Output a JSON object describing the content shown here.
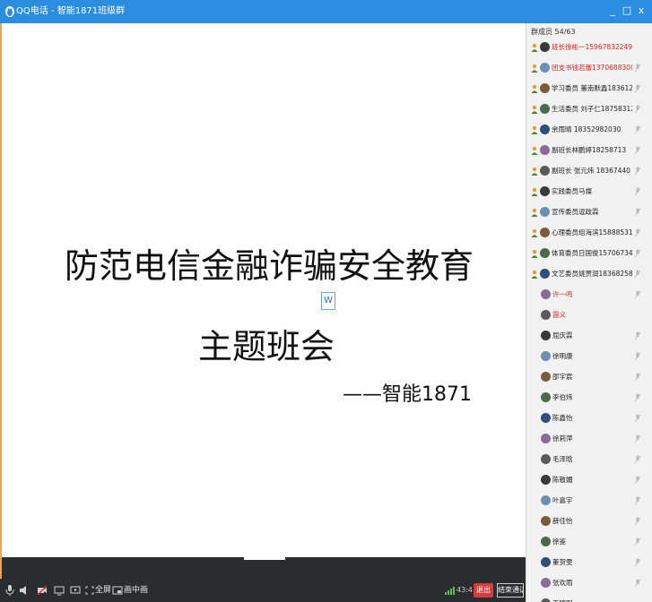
{
  "window": {
    "title": "QQ电话 - 智能1871班级群",
    "min_glyph": "_",
    "max_glyph": "□",
    "close_glyph": "x"
  },
  "slide": {
    "title_line1": "防范电信金融诈骗安全教育",
    "title_line2": "主题班会",
    "subtitle": "——智能1871",
    "marker": "W"
  },
  "toolbar": {
    "fullscreen_label": "全屏",
    "pip_label": "画中画",
    "time": "43:41",
    "exit_label": "退出",
    "end_label": "结束通话"
  },
  "panel": {
    "header": "群成员 54/63",
    "members": [
      {
        "name": "班长徐彬一15967832249",
        "color": "#e02020",
        "role": true,
        "mic": false
      },
      {
        "name": "团支书钱若蕾13706883001",
        "color": "#e02020",
        "role": true,
        "mic": true
      },
      {
        "name": "学习委员 董南默鑫18361234",
        "color": "#222222",
        "role": true,
        "mic": true
      },
      {
        "name": "生活委员 刘子仁18758312",
        "color": "#222222",
        "role": true,
        "mic": true
      },
      {
        "name": "余雨晴 18352982030",
        "color": "#222222",
        "role": true,
        "mic": true
      },
      {
        "name": "副班长林鹏婷18258713",
        "color": "#222222",
        "role": true,
        "mic": true
      },
      {
        "name": "副班长 张元炜 18367440",
        "color": "#222222",
        "role": true,
        "mic": true
      },
      {
        "name": "实践委员马燦",
        "color": "#222222",
        "role": true,
        "mic": true
      },
      {
        "name": "宣传委员逗政霖",
        "color": "#222222",
        "role": true,
        "mic": true
      },
      {
        "name": "心理委员组海滨15888531",
        "color": "#222222",
        "role": true,
        "mic": true
      },
      {
        "name": "体育委员日国俊15706734",
        "color": "#222222",
        "role": true,
        "mic": true
      },
      {
        "name": "文艺委员姚贾润18368258",
        "color": "#222222",
        "role": true,
        "mic": true
      },
      {
        "name": "许一鸣",
        "color": "#e02020",
        "role": false,
        "mic": true
      },
      {
        "name": "霞义",
        "color": "#e02020",
        "role": false,
        "mic": false
      },
      {
        "name": "屈庆霖",
        "color": "#222222",
        "role": false,
        "mic": true
      },
      {
        "name": "徐明康",
        "color": "#222222",
        "role": false,
        "mic": true
      },
      {
        "name": "邵宇宸",
        "color": "#222222",
        "role": false,
        "mic": true
      },
      {
        "name": "李伯炜",
        "color": "#222222",
        "role": false,
        "mic": true
      },
      {
        "name": "陈鑫怡",
        "color": "#222222",
        "role": false,
        "mic": true
      },
      {
        "name": "徐莉萍",
        "color": "#222222",
        "role": false,
        "mic": true
      },
      {
        "name": "毛泽晗",
        "color": "#222222",
        "role": false,
        "mic": true
      },
      {
        "name": "陈敬媚",
        "color": "#222222",
        "role": false,
        "mic": true
      },
      {
        "name": "叶嘉宇",
        "color": "#222222",
        "role": false,
        "mic": true
      },
      {
        "name": "薛佳怡",
        "color": "#222222",
        "role": false,
        "mic": true
      },
      {
        "name": "徐鉴",
        "color": "#222222",
        "role": false,
        "mic": true
      },
      {
        "name": "董贺雯",
        "color": "#222222",
        "role": false,
        "mic": true
      },
      {
        "name": "张欢雨",
        "color": "#222222",
        "role": false,
        "mic": true
      },
      {
        "name": "王锦阳",
        "color": "#222222",
        "role": false,
        "mic": false
      }
    ]
  },
  "colors": {
    "titlebar": "#2b8de0",
    "toolbar": "#2a2c30",
    "exit_button": "#d93a3a",
    "panel_bg": "#f2f2f2",
    "highlight_name": "#e02020"
  }
}
